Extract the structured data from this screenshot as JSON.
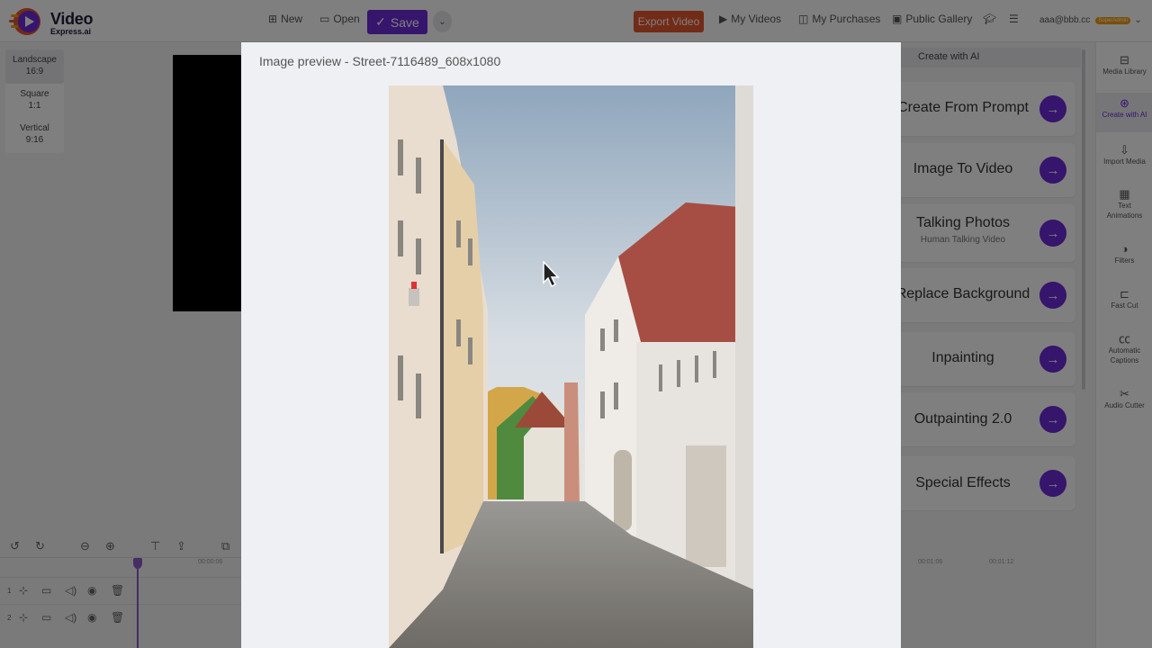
{
  "header": {
    "logo_line1": "Video",
    "logo_line2": "Express.ai",
    "new_label": "New",
    "open_label": "Open",
    "save_label": "Save",
    "export_label": "Export Video",
    "my_videos_label": "My Videos",
    "my_purchases_label": "My Purchases",
    "public_gallery_label": "Public Gallery",
    "user_email": "aaa@bbb.cc",
    "user_badge": "SuperAdmin"
  },
  "aspect": {
    "items": [
      {
        "name": "Landscape",
        "ratio": "16:9"
      },
      {
        "name": "Square",
        "ratio": "1:1"
      },
      {
        "name": "Vertical",
        "ratio": "9:16"
      }
    ]
  },
  "timeline": {
    "tick_left": "00:00:06",
    "tick_right_1": "00:01:06",
    "tick_right_2": "00:01:12",
    "track1": "1",
    "track2": "2"
  },
  "ai_panel": {
    "header": "Create with AI",
    "cards": [
      {
        "title": "Create From Prompt",
        "subtitle": ""
      },
      {
        "title": "Image To Video",
        "subtitle": ""
      },
      {
        "title": "Talking Photos",
        "subtitle": "Human Talking Video"
      },
      {
        "title": "Replace Background",
        "subtitle": ""
      },
      {
        "title": "Inpainting",
        "subtitle": ""
      },
      {
        "title": "Outpainting 2.0",
        "subtitle": ""
      },
      {
        "title": "Special Effects",
        "subtitle": ""
      }
    ]
  },
  "side_nav": {
    "items": [
      {
        "label": "Media Library",
        "icon": "media-library-icon"
      },
      {
        "label": "Create with AI",
        "icon": "robot-icon"
      },
      {
        "label": "Import Media",
        "icon": "import-icon"
      },
      {
        "label": "Text Animations",
        "icon": "text-animation-icon"
      },
      {
        "label": "Filters",
        "icon": "filter-icon"
      },
      {
        "label": "Fast Cut",
        "icon": "fast-cut-icon"
      },
      {
        "label": "Automatic Captions",
        "icon": "captions-icon"
      },
      {
        "label": "Audio Cutter",
        "icon": "scissors-icon"
      }
    ]
  },
  "modal": {
    "title": "Image preview - Street-7116489_608x1080"
  },
  "colors": {
    "accent": "#6c2bd9",
    "export": "#e4572e",
    "badge": "#f59e0b"
  }
}
